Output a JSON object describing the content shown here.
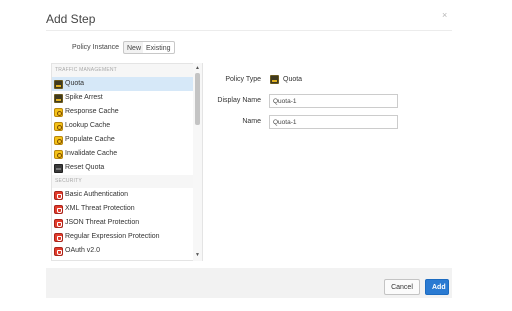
{
  "dialog": {
    "title": "Add Step",
    "close_glyph": "×"
  },
  "policy_instance": {
    "label": "Policy Instance",
    "options": [
      "New",
      "Existing"
    ],
    "selected": "New"
  },
  "policy_list": {
    "sections": [
      {
        "header": "TRAFFIC MANAGEMENT",
        "items": [
          {
            "label": "Quota",
            "icon": "quota-icon",
            "selected": true
          },
          {
            "label": "Spike Arrest",
            "icon": "spike-arrest-icon"
          },
          {
            "label": "Response Cache",
            "icon": "response-cache-icon"
          },
          {
            "label": "Lookup Cache",
            "icon": "lookup-cache-icon"
          },
          {
            "label": "Populate Cache",
            "icon": "populate-cache-icon"
          },
          {
            "label": "Invalidate Cache",
            "icon": "invalidate-cache-icon"
          },
          {
            "label": "Reset Quota",
            "icon": "reset-quota-icon"
          }
        ]
      },
      {
        "header": "SECURITY",
        "items": [
          {
            "label": "Basic Authentication",
            "icon": "basic-auth-icon"
          },
          {
            "label": "XML Threat Protection",
            "icon": "xml-threat-icon"
          },
          {
            "label": "JSON Threat Protection",
            "icon": "json-threat-icon"
          },
          {
            "label": "Regular Expression Protection",
            "icon": "regex-protection-icon"
          },
          {
            "label": "OAuth v2.0",
            "icon": "oauth-icon"
          }
        ]
      }
    ]
  },
  "form": {
    "policy_type_label": "Policy Type",
    "policy_type_value": "Quota",
    "display_name_label": "Display Name",
    "display_name_value": "Quota-1",
    "name_label": "Name",
    "name_value": "Quota-1"
  },
  "footer": {
    "cancel_label": "Cancel",
    "add_label": "Add"
  },
  "colors": {
    "accent": "#2a7ad2",
    "selected_row": "#d6e8f8",
    "security_icon": "#e23a2a",
    "cache_icon": "#f5c218"
  }
}
